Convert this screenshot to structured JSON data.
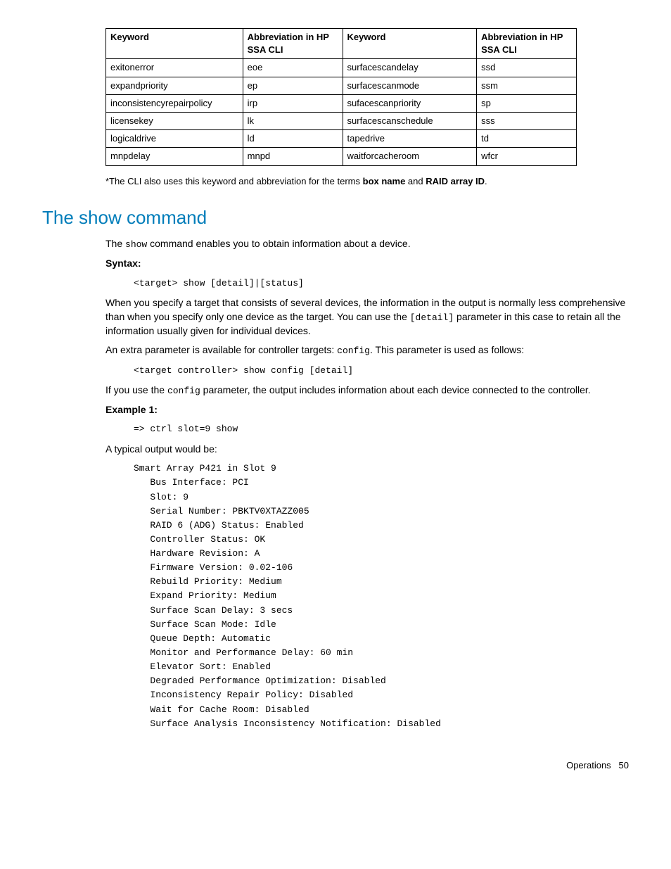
{
  "table": {
    "headers": [
      "Keyword",
      "Abbreviation in HP SSA CLI",
      "Keyword",
      "Abbreviation in HP SSA CLI"
    ],
    "rows": [
      [
        "exitonerror",
        "eoe",
        "surfacescandelay",
        "ssd"
      ],
      [
        "expandpriority",
        "ep",
        "surfacescanmode",
        "ssm"
      ],
      [
        "inconsistencyrepairpolicy",
        "irp",
        "sufacescanpriority",
        "sp"
      ],
      [
        "licensekey",
        "lk",
        "surfacescanschedule",
        "sss"
      ],
      [
        "logicaldrive",
        "ld",
        "tapedrive",
        "td"
      ],
      [
        "mnpdelay",
        "mnpd",
        "waitforcacheroom",
        "wfcr"
      ]
    ]
  },
  "footnote_prefix": "*The CLI also uses this keyword and abbreviation for the terms ",
  "footnote_bold1": "box name",
  "footnote_mid": " and ",
  "footnote_bold2": "RAID array ID",
  "footnote_suffix": ".",
  "section_title": "The show command",
  "intro_pre": "The ",
  "intro_code": "show",
  "intro_post": " command enables you to obtain information about a device.",
  "syntax_label": "Syntax:",
  "syntax_code": "<target> show [detail]|[status]",
  "para2_pre": "When you specify a target that consists of several devices, the information in the output is normally less comprehensive than when you specify only one device as the target. You can use the ",
  "para2_code": "[detail]",
  "para2_post": " parameter in this case to retain all the information usually given for individual devices.",
  "para3_pre": "An extra parameter is available for controller targets: ",
  "para3_code": "config",
  "para3_post": ". This parameter is used as follows:",
  "config_code": "<target controller> show config [detail]",
  "para4_pre": "If you use the ",
  "para4_code": "config",
  "para4_post": " parameter, the output includes information about each device connected to the controller.",
  "example_label": "Example 1:",
  "example_cmd": "=> ctrl slot=9 show",
  "output_intro": "A typical output would be:",
  "output_block": "Smart Array P421 in Slot 9\n   Bus Interface: PCI\n   Slot: 9\n   Serial Number: PBKTV0XTAZZ005\n   RAID 6 (ADG) Status: Enabled\n   Controller Status: OK\n   Hardware Revision: A\n   Firmware Version: 0.02-106\n   Rebuild Priority: Medium\n   Expand Priority: Medium\n   Surface Scan Delay: 3 secs\n   Surface Scan Mode: Idle\n   Queue Depth: Automatic\n   Monitor and Performance Delay: 60 min\n   Elevator Sort: Enabled\n   Degraded Performance Optimization: Disabled\n   Inconsistency Repair Policy: Disabled\n   Wait for Cache Room: Disabled\n   Surface Analysis Inconsistency Notification: Disabled",
  "footer_section": "Operations",
  "footer_page": "50"
}
